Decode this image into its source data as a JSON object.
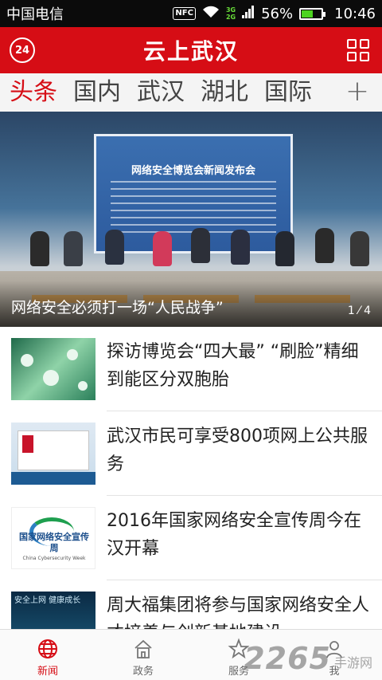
{
  "status_bar": {
    "carrier": "中国电信",
    "nfc": "NFC",
    "network_top": "3G",
    "network_bottom": "2G",
    "battery": "56%",
    "battery_level": 0.56,
    "time": "10:46"
  },
  "header": {
    "title": "云上武汉",
    "weather_value": "24"
  },
  "tabs": [
    {
      "label": "头条",
      "active": true
    },
    {
      "label": "国内",
      "active": false
    },
    {
      "label": "武汉",
      "active": false
    },
    {
      "label": "湖北",
      "active": false
    },
    {
      "label": "国际",
      "active": false
    }
  ],
  "tab_add_label": "+",
  "hero": {
    "caption": "网络安全必须打一场“人民战争”",
    "screen_title": "网络安全博览会新闻发布会",
    "page_current": "1",
    "page_total": "4"
  },
  "news": [
    {
      "title": "探访博览会“四大最” “刷脸”精细到能区分双胞胎"
    },
    {
      "title": "武汉市民可享受800项网上公共服务"
    },
    {
      "title": "2016年国家网络安全宣传周今在汉开幕",
      "thumb_text": "国家网络安全宣传周",
      "thumb_sub": "China Cybersecurity Week"
    },
    {
      "title": "周大福集团将参与国家网络安全人才培养与创新基地建设",
      "thumb_text": "安全上网 健康成长"
    }
  ],
  "bottom_nav": [
    {
      "label": "新闻",
      "icon": "globe-icon",
      "active": true
    },
    {
      "label": "政务",
      "icon": "building-icon",
      "active": false
    },
    {
      "label": "服务",
      "icon": "star-icon",
      "active": false
    },
    {
      "label": "我",
      "icon": "person-icon",
      "active": false
    }
  ],
  "watermark": {
    "number": "2265",
    "text": "手游网"
  },
  "colors": {
    "brand_red": "#d60d15",
    "tab_bg": "#f4f4f4",
    "status_bg": "#0b0b0b"
  }
}
